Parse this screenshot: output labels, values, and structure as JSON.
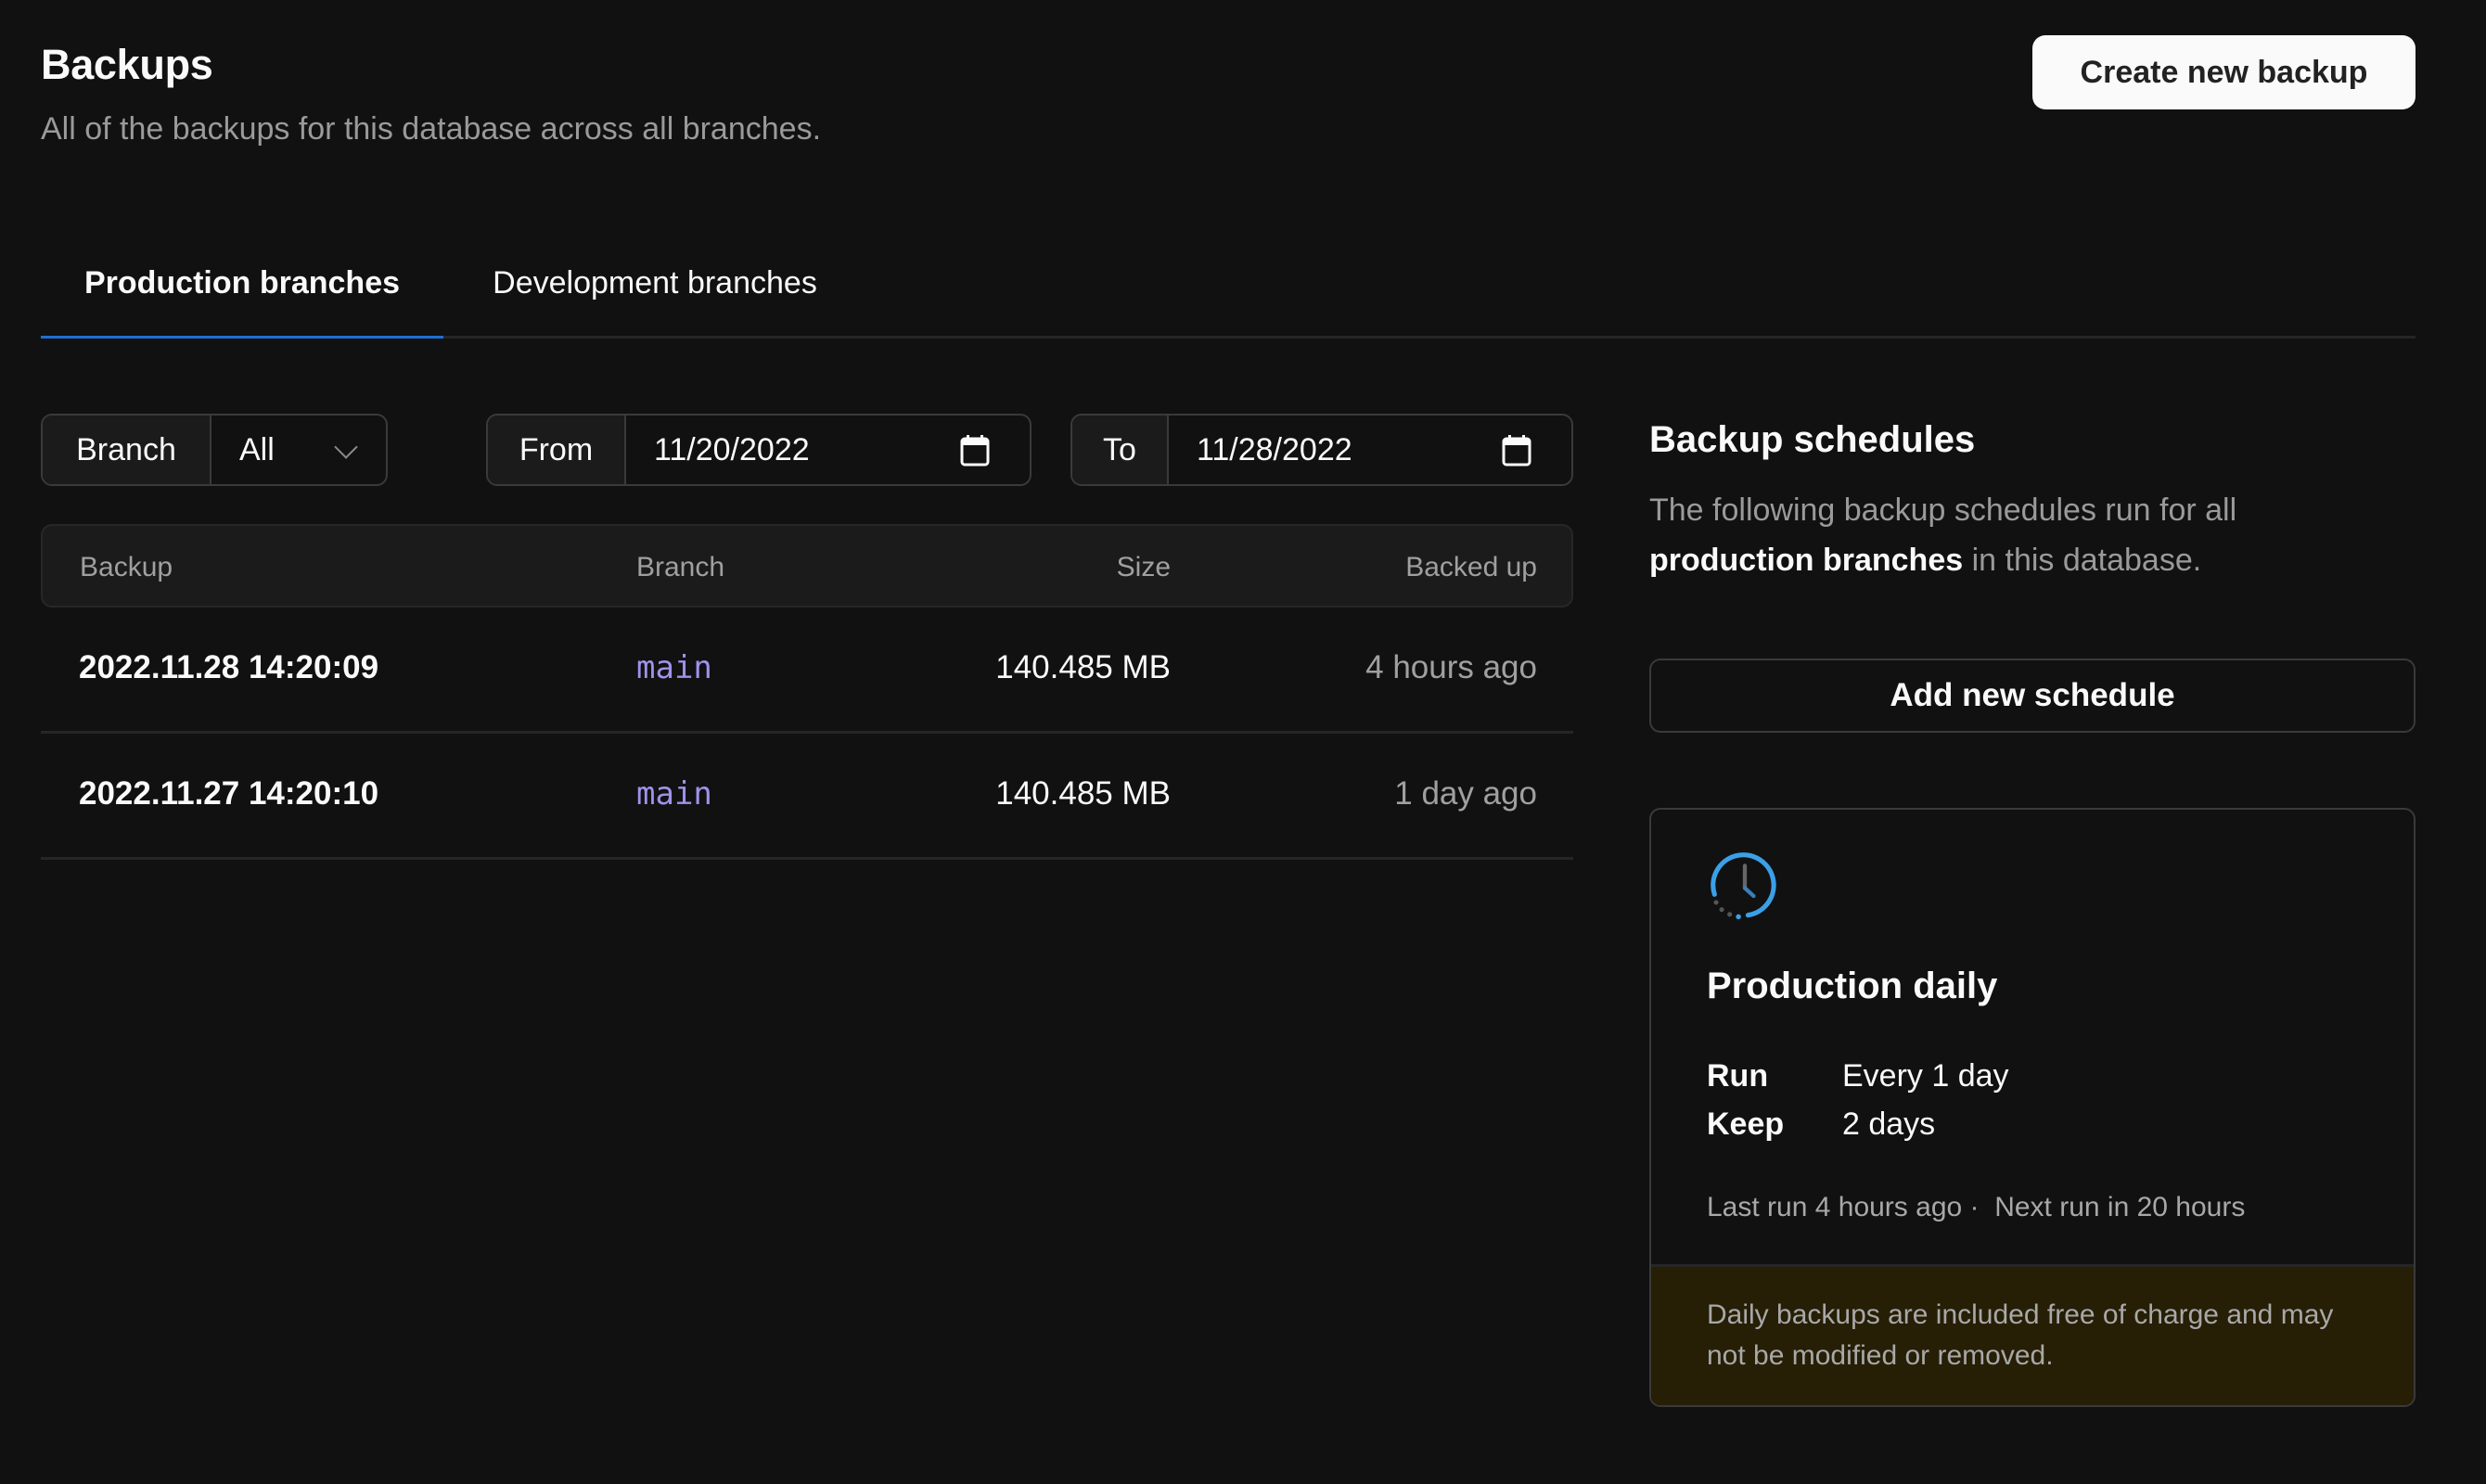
{
  "header": {
    "title": "Backups",
    "subtitle": "All of the backups for this database across all branches.",
    "create_button": "Create new backup"
  },
  "tabs": [
    {
      "label": "Production branches",
      "active": true
    },
    {
      "label": "Development branches",
      "active": false
    }
  ],
  "filters": {
    "branch": {
      "label": "Branch",
      "value": "All",
      "icon": "chevron-down-icon"
    },
    "from": {
      "label": "From",
      "value": "11/20/2022",
      "icon": "calendar-icon"
    },
    "to": {
      "label": "To",
      "value": "11/28/2022",
      "icon": "calendar-icon"
    }
  },
  "table": {
    "columns": [
      "Backup",
      "Branch",
      "Size",
      "Backed up"
    ],
    "rows": [
      {
        "backup": "2022.11.28 14:20:09",
        "branch": "main",
        "size": "140.485 MB",
        "backed_up": "4 hours ago"
      },
      {
        "backup": "2022.11.27 14:20:10",
        "branch": "main",
        "size": "140.485 MB",
        "backed_up": "1 day ago"
      }
    ]
  },
  "schedules": {
    "title": "Backup schedules",
    "description_prefix": "The following backup schedules run for all ",
    "description_bold": "production branches",
    "description_suffix": " in this database.",
    "add_button": "Add new schedule",
    "cards": [
      {
        "icon": "clock-icon",
        "title": "Production daily",
        "run_label": "Run",
        "run_value": "Every 1 day",
        "keep_label": "Keep",
        "keep_value": "2 days",
        "last_run": "Last run 4 hours ago",
        "separator": "·",
        "next_run": "Next run in 20 hours",
        "footer_note": "Daily backups are included free of charge and may not be modified or removed."
      }
    ]
  },
  "colors": {
    "background": "#111111",
    "accent_tab": "#1f6fd0",
    "branch_text": "#a191ec",
    "clock_arc": "#3aa0e8",
    "footer_bg": "#261e05"
  }
}
